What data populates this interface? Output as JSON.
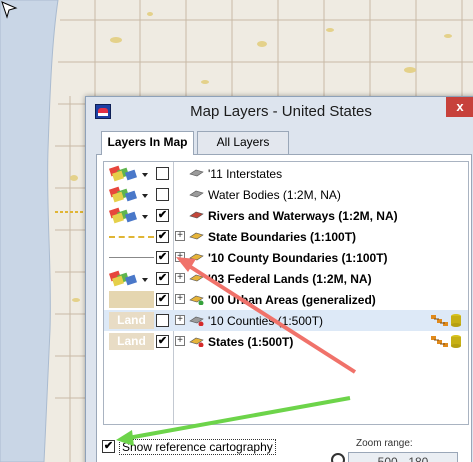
{
  "dialog": {
    "title": "Map Layers - United States",
    "close_glyph": "x",
    "tabs": [
      {
        "label": "Layers In Map",
        "active": true
      },
      {
        "label": "All Layers",
        "active": false
      }
    ],
    "layers": [
      {
        "name": "'11 Interstates",
        "checked": false,
        "bold": false,
        "symbol": "palette",
        "icon": "gray-diamond-icon",
        "expandable": false
      },
      {
        "name": "Water Bodies (1:2M, NA)",
        "checked": false,
        "bold": false,
        "symbol": "palette",
        "icon": "gray-diamond-icon",
        "expandable": false
      },
      {
        "name": "Rivers and Waterways (1:2M, NA)",
        "checked": true,
        "bold": true,
        "symbol": "palette",
        "icon": "color-diamond-icon",
        "expandable": false
      },
      {
        "name": "State Boundaries (1:100T)",
        "checked": true,
        "bold": true,
        "symbol": "dashed-line",
        "icon": "yellow-diamond-icon",
        "expandable": true
      },
      {
        "name": "'10 County Boundaries (1:100T)",
        "checked": true,
        "bold": true,
        "symbol": "thin-line",
        "icon": "yellow-diamond-icon",
        "expandable": true
      },
      {
        "name": "'03 Federal Lands (1:2M, NA)",
        "checked": true,
        "bold": true,
        "symbol": "palette",
        "icon": "yellow-diamond-icon",
        "expandable": true
      },
      {
        "name": "'00 Urban Areas (generalized)",
        "checked": true,
        "bold": true,
        "symbol": "urban-fill",
        "icon": "yellow-diamond-green-dot-icon",
        "expandable": true
      },
      {
        "name": "'10 Counties (1:500T)",
        "checked": false,
        "bold": false,
        "symbol": "land",
        "symbol_text": "Land",
        "icon": "gray-diamond-red-dot-icon",
        "expandable": true,
        "selected": true,
        "tools": true
      },
      {
        "name": "States (1:500T)",
        "checked": true,
        "bold": true,
        "symbol": "land",
        "symbol_text": "Land",
        "icon": "yellow-diamond-red-dot-icon",
        "expandable": true,
        "tools": true
      }
    ],
    "show_reference_label": "Show reference cartography",
    "show_reference_checked": true,
    "zoom_range_label": "Zoom range:",
    "zoom_range_value": "500 - 180"
  },
  "colors": {
    "arrow_red": "#f0726a",
    "arrow_green": "#6dd44a",
    "selection": "#dde9f7",
    "water": "#c9d6e6"
  }
}
